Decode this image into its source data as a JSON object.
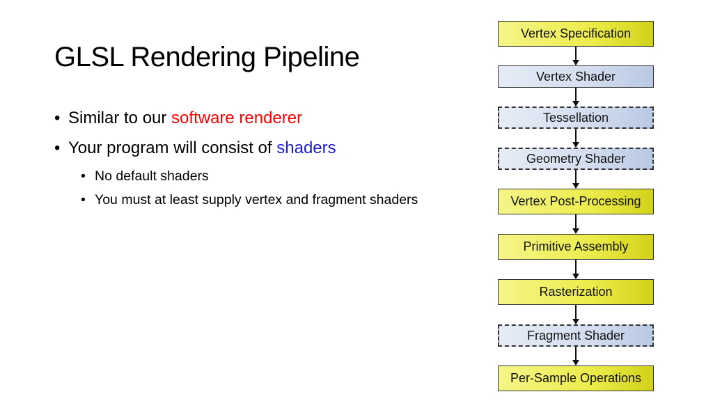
{
  "slide": {
    "title": "GLSL Rendering Pipeline",
    "bullets": [
      {
        "prefix": "Similar to our ",
        "highlight": "software renderer",
        "highlight_color": "#ff0000"
      },
      {
        "prefix": "Your program will consist of ",
        "highlight": "shaders",
        "highlight_color": "#1a1ad6",
        "sub": [
          "No default shaders",
          "You must at least supply vertex and fragment shaders"
        ]
      }
    ],
    "bullet_glyph": "•"
  },
  "pipeline": {
    "stages": [
      {
        "label": "Vertex Specification",
        "kind": "fixed"
      },
      {
        "label": "Vertex Shader",
        "kind": "programmable"
      },
      {
        "label": "Tessellation",
        "kind": "optional-programmable"
      },
      {
        "label": "Geometry Shader",
        "kind": "optional-programmable"
      },
      {
        "label": "Vertex Post-Processing",
        "kind": "fixed"
      },
      {
        "label": "Primitive Assembly",
        "kind": "fixed"
      },
      {
        "label": "Rasterization",
        "kind": "fixed"
      },
      {
        "label": "Fragment Shader",
        "kind": "optional-programmable"
      },
      {
        "label": "Per-Sample Operations",
        "kind": "fixed"
      }
    ],
    "colors": {
      "fixed": "#ecec4a",
      "programmable": "#d3ddee"
    }
  }
}
